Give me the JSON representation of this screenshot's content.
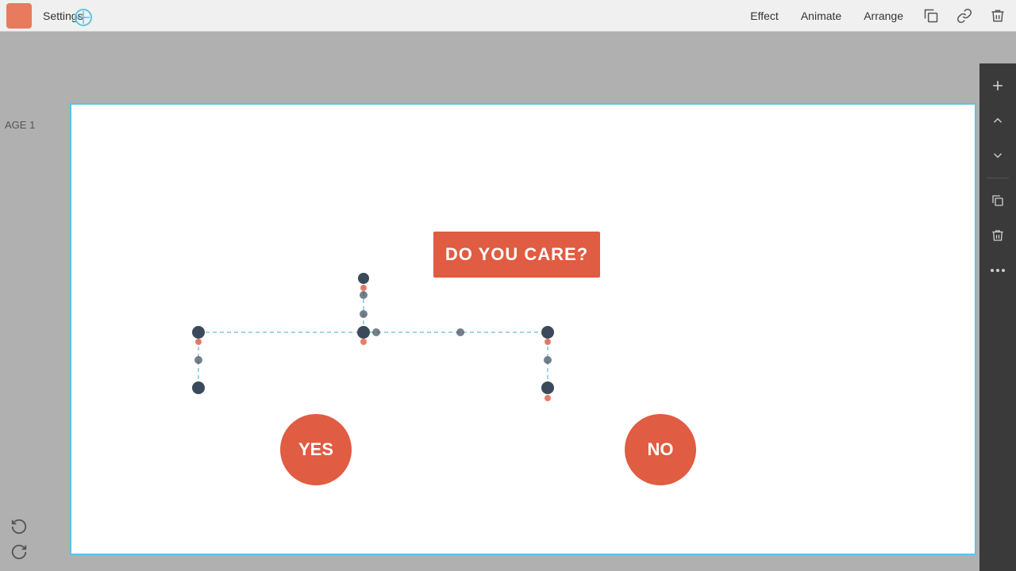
{
  "topbar": {
    "settings_label": "Settings",
    "effect_label": "Effect",
    "animate_label": "Animate",
    "arrange_label": "Arrange"
  },
  "page": {
    "label": "AGE 1"
  },
  "canvas": {
    "question_text": "DO YOU CARE?",
    "yes_text": "YES",
    "no_text": "NO"
  },
  "sidebar": {
    "add_icon": "+",
    "move_up_icon": "↑",
    "move_down_icon": "↓",
    "duplicate_icon": "⧉",
    "delete_icon": "🗑",
    "more_icon": "···"
  }
}
